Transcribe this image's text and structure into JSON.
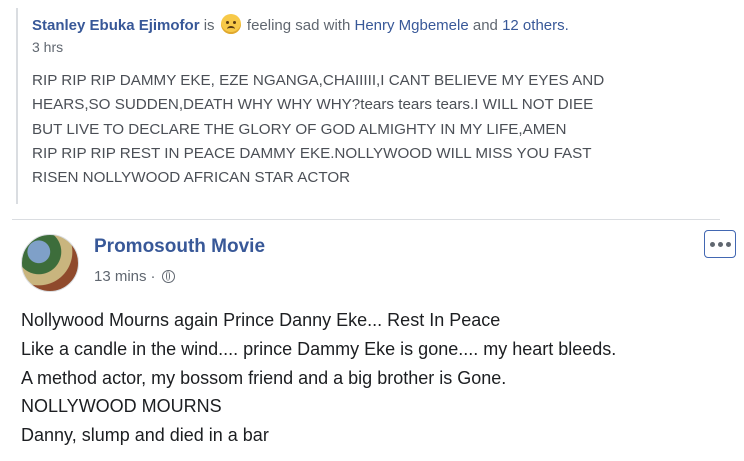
{
  "shared": {
    "author": "Stanley Ebuka Ejimofor",
    "is_word": "is",
    "feeling_text": "feeling sad with",
    "tagged": "Henry Mgbemele",
    "and_word": "and",
    "others": "12 others.",
    "time": "3 hrs",
    "emoji_icon": "sad-face-icon",
    "body": "RIP RIP RIP DAMMY EKE, EZE NGANGA,CHAIIIII,I CANT BELIEVE MY EYES AND\nHEARS,SO SUDDEN,DEATH WHY WHY WHY?tears tears tears.I WILL NOT DIEE\nBUT LIVE TO DECLARE THE GLORY OF GOD ALMIGHTY IN MY LIFE,AMEN\nRIP RIP RIP REST IN PEACE DAMMY EKE.NOLLYWOOD WILL MISS YOU FAST\nRISEN NOLLYWOOD AFRICAN STAR ACTOR"
  },
  "post": {
    "author": "Promosouth Movie",
    "time": "13 mins",
    "separator": "·",
    "privacy_icon": "globe-icon",
    "more_icon": "more-options-icon",
    "text": "Nollywood Mourns again Prince Danny Eke... Rest In Peace\nLike a candle in the wind.... prince Dammy Eke is gone.... my heart bleeds.\nA method actor, my bossom friend and a big brother is Gone.\nNOLLYWOOD MOURNS\nDanny, slump and died in a bar"
  },
  "colors": {
    "link": "#385898",
    "muted": "#606770",
    "text": "#1c1e21",
    "accent_border": "#4267b2"
  }
}
